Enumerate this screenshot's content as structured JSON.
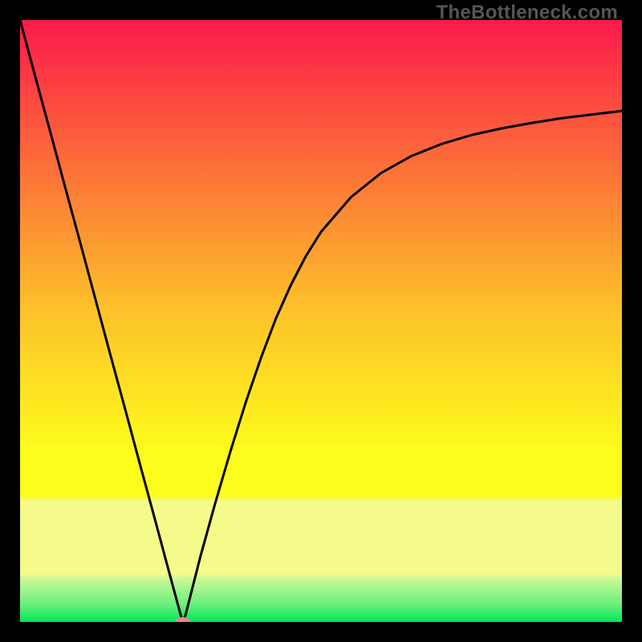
{
  "watermark": "TheBottleneck.com",
  "colors": {
    "bg": "#000000",
    "gradient_top": "#fb1a4a",
    "gradient_mid_upper": "#fc6e39",
    "gradient_mid": "#fdc12a",
    "gradient_mid_lower": "#fdfd1b",
    "gradient_band": "#f4fb8a",
    "gradient_bottom": "#00e756",
    "curve": "#000000",
    "marker": "#e58a8a"
  },
  "chart_data": {
    "type": "line",
    "title": "",
    "xlabel": "",
    "ylabel": "",
    "xlim": [
      0,
      100
    ],
    "ylim": [
      0,
      100
    ],
    "annotations": [],
    "series": [
      {
        "name": "bottleneck-curve",
        "x": [
          0.0,
          2.5,
          5.0,
          7.5,
          10.0,
          12.5,
          15.0,
          17.5,
          20.0,
          22.5,
          25.0,
          27.0,
          27.5,
          30.0,
          32.5,
          35.0,
          37.5,
          40.0,
          42.5,
          45.0,
          47.5,
          50.0,
          55.0,
          60.0,
          65.0,
          70.0,
          75.0,
          80.0,
          85.0,
          90.0,
          95.0,
          100.0
        ],
        "values": [
          100.0,
          90.7,
          81.5,
          72.2,
          63.0,
          53.7,
          44.4,
          35.2,
          25.9,
          16.7,
          7.4,
          0.0,
          1.2,
          11.0,
          20.0,
          28.5,
          36.5,
          43.8,
          50.4,
          56.0,
          60.8,
          64.8,
          70.6,
          74.6,
          77.4,
          79.4,
          80.9,
          82.0,
          82.9,
          83.7,
          84.3,
          84.9
        ]
      }
    ],
    "marker": {
      "x": 27.0,
      "y": 0.0,
      "color": "#e58a8a"
    }
  }
}
